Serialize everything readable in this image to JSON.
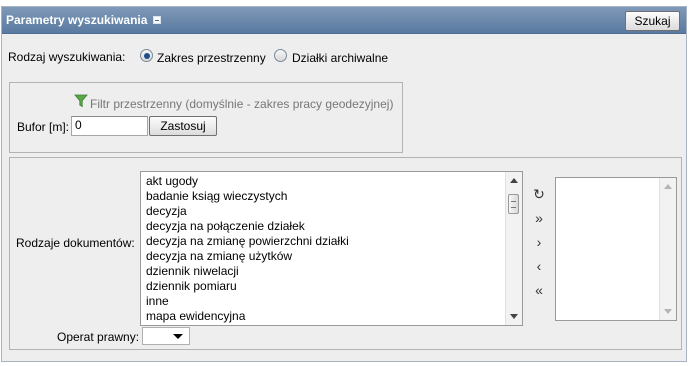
{
  "header": {
    "title": "Parametry wyszukiwania",
    "collapse_icon": "minus-square-icon",
    "search_button": "Szukaj"
  },
  "search_type": {
    "label": "Rodzaj wyszukiwania:",
    "options": [
      {
        "label": "Zakres przestrzenny",
        "selected": true
      },
      {
        "label": "Działki archiwalne",
        "selected": false
      }
    ]
  },
  "spatial_filter": {
    "icon": "funnel-icon",
    "hint": "Filtr przestrzenny (domyślnie - zakres pracy geodezyjnej)",
    "buffer_label": "Bufor [m]:",
    "buffer_value": "0",
    "apply_button": "Zastosuj"
  },
  "documents": {
    "label": "Rodzaje dokumentów:",
    "items": [
      "akt ugody",
      "badanie ksiąg wieczystych",
      "decyzja",
      "decyzja na połączenie działek",
      "decyzja na zmianę powierzchni działki",
      "decyzja na zmianę użytków",
      "dziennik niwelacji",
      "dziennik pomiaru",
      "inne",
      "mapa ewidencyjna"
    ],
    "controls": [
      {
        "name": "refresh-button",
        "icon": "refresh-icon",
        "glyph": "↻"
      },
      {
        "name": "move-all-right-button",
        "icon": "double-chevron-right-icon",
        "glyph": "»"
      },
      {
        "name": "move-right-button",
        "icon": "chevron-right-icon",
        "glyph": "›"
      },
      {
        "name": "move-left-button",
        "icon": "chevron-left-icon",
        "glyph": "‹"
      },
      {
        "name": "move-all-left-button",
        "icon": "double-chevron-left-icon",
        "glyph": "«"
      }
    ],
    "selected_items": []
  },
  "legal_operation": {
    "label": "Operat prawny:",
    "value": ""
  },
  "colors": {
    "header_bg": "#6c88ad",
    "panel_bg": "#eeeeee"
  }
}
